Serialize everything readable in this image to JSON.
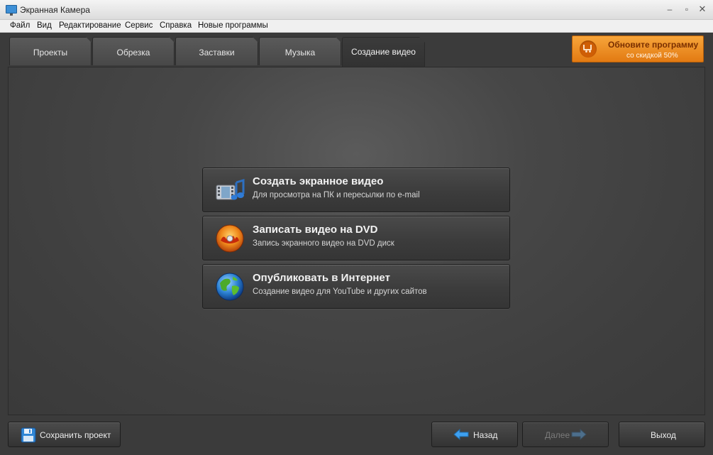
{
  "window": {
    "title": "Экранная Камера"
  },
  "menu": [
    "Файл",
    "Вид",
    "Редактирование",
    "Сервис",
    "Справка",
    "Новые программы"
  ],
  "tabs": [
    {
      "label": "Проекты",
      "active": false
    },
    {
      "label": "Обрезка",
      "active": false
    },
    {
      "label": "Заставки",
      "active": false
    },
    {
      "label": "Музыка",
      "active": false
    },
    {
      "label": "Создание видео",
      "active": true
    }
  ],
  "upgrade": {
    "title": "Обновите программу",
    "subtitle": "со скидкой 50%",
    "icon": "cart-icon"
  },
  "options": [
    {
      "title": "Создать экранное видео",
      "subtitle": "Для просмотра на ПК и пересылки по e-mail",
      "icon": "film-music-icon"
    },
    {
      "title": "Записать видео на DVD",
      "subtitle": "Запись экранного видео на DVD диск",
      "icon": "dvd-disc-icon"
    },
    {
      "title": "Опубликовать в Интернет",
      "subtitle": "Создание видео для YouTube и других сайтов",
      "icon": "globe-icon"
    }
  ],
  "footer": {
    "save": "Сохранить проект",
    "back": "Назад",
    "next": "Далее",
    "exit": "Выход"
  }
}
